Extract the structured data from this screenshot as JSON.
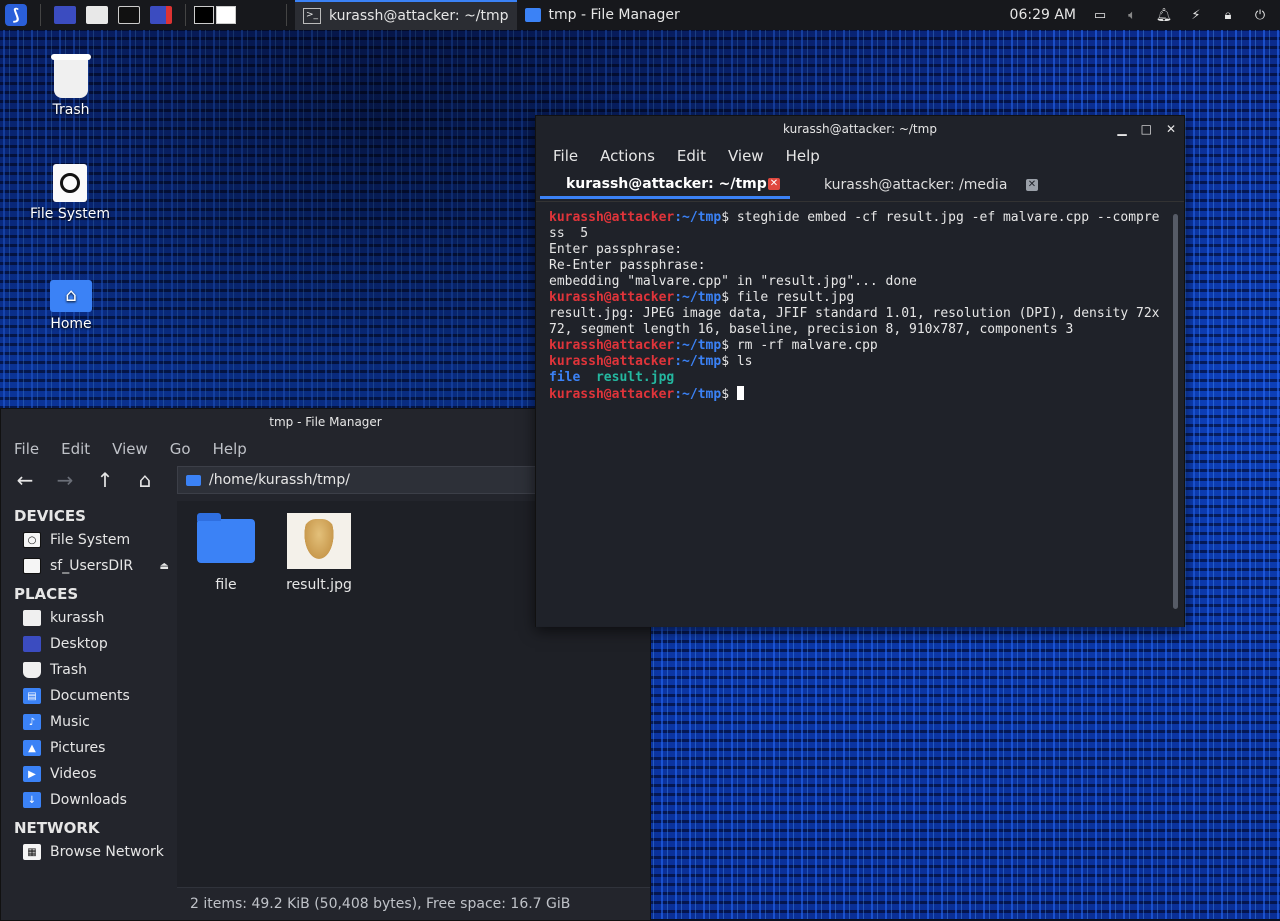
{
  "panel": {
    "workspace_count": 2,
    "tasks": [
      {
        "label": "kurassh@attacker: ~/tmp",
        "active": true
      },
      {
        "label": "tmp - File Manager",
        "active": false
      }
    ],
    "clock": "06:29 AM"
  },
  "desktop": {
    "icons": [
      {
        "label": "Trash"
      },
      {
        "label": "File System"
      },
      {
        "label": "Home"
      }
    ]
  },
  "terminal": {
    "title": "kurassh@attacker: ~/tmp",
    "menu": [
      "File",
      "Actions",
      "Edit",
      "View",
      "Help"
    ],
    "tabs": [
      {
        "label": "kurassh@attacker: ~/tmp"
      },
      {
        "label": "kurassh@attacker: /media"
      }
    ],
    "prompt_user": "kurassh@attacker",
    "prompt_path": ":~/tmp",
    "lines": [
      {
        "cmd": "steghide embed -cf result.jpg -ef malvare.cpp --compress  5"
      },
      {
        "out": "Enter passphrase:"
      },
      {
        "out": "Re-Enter passphrase:"
      },
      {
        "out": "embedding \"malvare.cpp\" in \"result.jpg\"... done"
      },
      {
        "cmd": "file result.jpg"
      },
      {
        "out": "result.jpg: JPEG image data, JFIF standard 1.01, resolution (DPI), density 72x72, segment length 16, baseline, precision 8, 910x787, components 3"
      },
      {
        "cmd": "rm -rf malvare.cpp"
      },
      {
        "cmd": "ls"
      }
    ],
    "ls_dir": "file",
    "ls_file": "result.jpg"
  },
  "filemgr": {
    "title": "tmp - File Manager",
    "menu": [
      "File",
      "Edit",
      "View",
      "Go",
      "Help"
    ],
    "location": "/home/kurassh/tmp/",
    "sidebar": {
      "devices_header": "DEVICES",
      "devices": [
        {
          "label": "File System"
        },
        {
          "label": "sf_UsersDIR"
        }
      ],
      "places_header": "PLACES",
      "places": [
        {
          "label": "kurassh"
        },
        {
          "label": "Desktop"
        },
        {
          "label": "Trash"
        },
        {
          "label": "Documents"
        },
        {
          "label": "Music"
        },
        {
          "label": "Pictures"
        },
        {
          "label": "Videos"
        },
        {
          "label": "Downloads"
        }
      ],
      "network_header": "NETWORK",
      "network": [
        {
          "label": "Browse Network"
        }
      ]
    },
    "items": [
      {
        "label": "file"
      },
      {
        "label": "result.jpg"
      }
    ],
    "status": "2 items: 49.2 KiB (50,408 bytes), Free space: 16.7 GiB"
  },
  "colors": {
    "accent": "#3b82f6",
    "prompt_user": "#e0343a",
    "image_file": "#24b8a0"
  }
}
